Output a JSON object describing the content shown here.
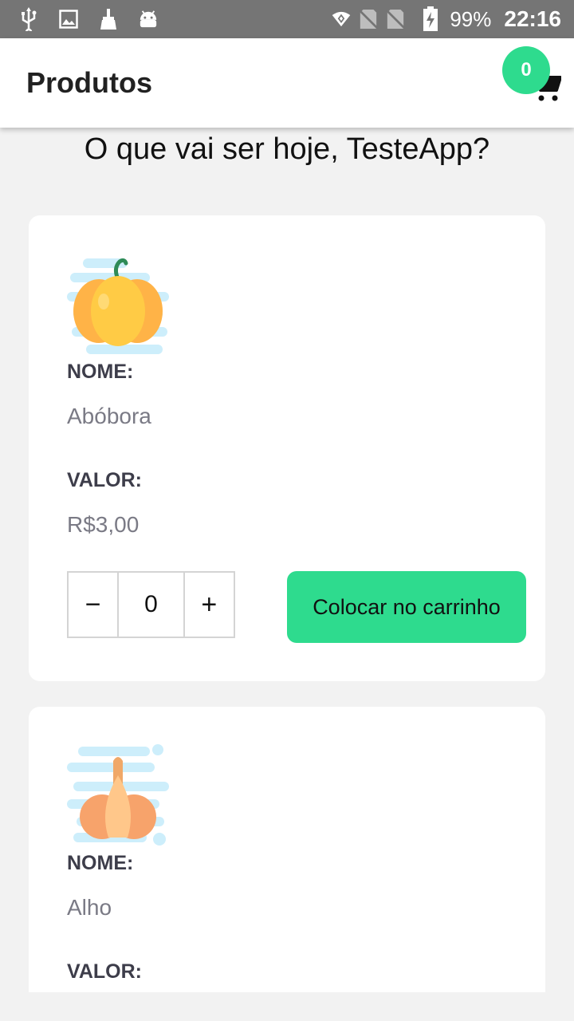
{
  "status_bar": {
    "battery": "99%",
    "time": "22:16",
    "icons": [
      "usb-icon",
      "image-icon",
      "broom-icon",
      "android-icon",
      "wifi-icon",
      "no-sim-icon",
      "no-sim-icon",
      "battery-charging-icon"
    ]
  },
  "app_bar": {
    "title": "Produtos",
    "cart_count": "0"
  },
  "greeting": "O que vai ser hoje, TesteApp?",
  "labels": {
    "name": "NOME:",
    "value": "VALOR:",
    "add_to_cart": "Colocar no carrinho",
    "minus": "−",
    "plus": "+"
  },
  "products": [
    {
      "name": "Abóbora",
      "price": "R$3,00",
      "quantity": "0",
      "icon": "pumpkin-icon"
    },
    {
      "name": "Alho",
      "icon": "garlic-icon"
    }
  ],
  "colors": {
    "accent": "#2edb8e",
    "status_bar": "#757575",
    "background": "#f2f2f2"
  }
}
